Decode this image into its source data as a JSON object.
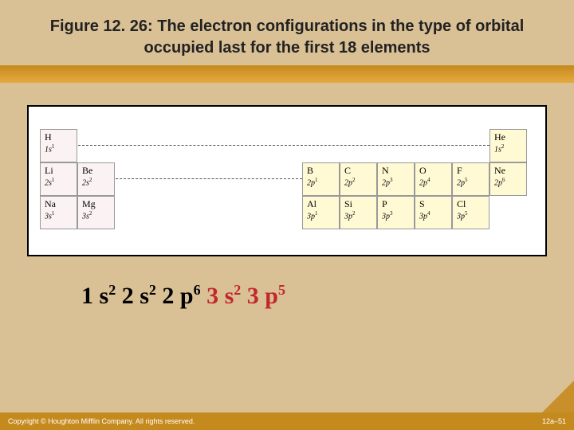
{
  "title": "Figure 12. 26:  The electron configurations in the type of orbital occupied last for the first 18 elements",
  "periodic": {
    "row1": [
      {
        "sym": "H",
        "conf_base": "1s",
        "conf_sup": "1",
        "col": 0,
        "type": "s"
      },
      {
        "sym": "He",
        "conf_base": "1s",
        "conf_sup": "2",
        "col": 12,
        "type": "p"
      }
    ],
    "row2": [
      {
        "sym": "Li",
        "conf_base": "2s",
        "conf_sup": "1",
        "col": 0,
        "type": "s"
      },
      {
        "sym": "Be",
        "conf_base": "2s",
        "conf_sup": "2",
        "col": 1,
        "type": "s"
      },
      {
        "sym": "B",
        "conf_base": "2p",
        "conf_sup": "1",
        "col": 7,
        "type": "p"
      },
      {
        "sym": "C",
        "conf_base": "2p",
        "conf_sup": "2",
        "col": 8,
        "type": "p"
      },
      {
        "sym": "N",
        "conf_base": "2p",
        "conf_sup": "3",
        "col": 9,
        "type": "p"
      },
      {
        "sym": "O",
        "conf_base": "2p",
        "conf_sup": "4",
        "col": 10,
        "type": "p"
      },
      {
        "sym": "F",
        "conf_base": "2p",
        "conf_sup": "5",
        "col": 11,
        "type": "p"
      },
      {
        "sym": "Ne",
        "conf_base": "2p",
        "conf_sup": "6",
        "col": 12,
        "type": "p"
      }
    ],
    "row3": [
      {
        "sym": "Na",
        "conf_base": "3s",
        "conf_sup": "1",
        "col": 0,
        "type": "s"
      },
      {
        "sym": "Mg",
        "conf_base": "3s",
        "conf_sup": "2",
        "col": 1,
        "type": "s"
      },
      {
        "sym": "Al",
        "conf_base": "3p",
        "conf_sup": "1",
        "col": 7,
        "type": "p"
      },
      {
        "sym": "Si",
        "conf_base": "3p",
        "conf_sup": "2",
        "col": 8,
        "type": "p"
      },
      {
        "sym": "P",
        "conf_base": "3p",
        "conf_sup": "3",
        "col": 9,
        "type": "p"
      },
      {
        "sym": "S",
        "conf_base": "3p",
        "conf_sup": "4",
        "col": 10,
        "type": "p"
      },
      {
        "sym": "Cl",
        "conf_base": "3p",
        "conf_sup": "5",
        "col": 11,
        "type": "p"
      }
    ]
  },
  "config_terms": [
    {
      "base": "1 s",
      "sup": "2",
      "color": "black"
    },
    {
      "base": "2 s",
      "sup": "2",
      "color": "black"
    },
    {
      "base": "2 p",
      "sup": "6",
      "color": "black"
    },
    {
      "base": "3 s",
      "sup": "2",
      "color": "red"
    },
    {
      "base": "3 p",
      "sup": "5",
      "color": "red"
    }
  ],
  "footer": {
    "left": "Copyright © Houghton Mifflin Company. All rights reserved.",
    "right": "12a–51"
  }
}
